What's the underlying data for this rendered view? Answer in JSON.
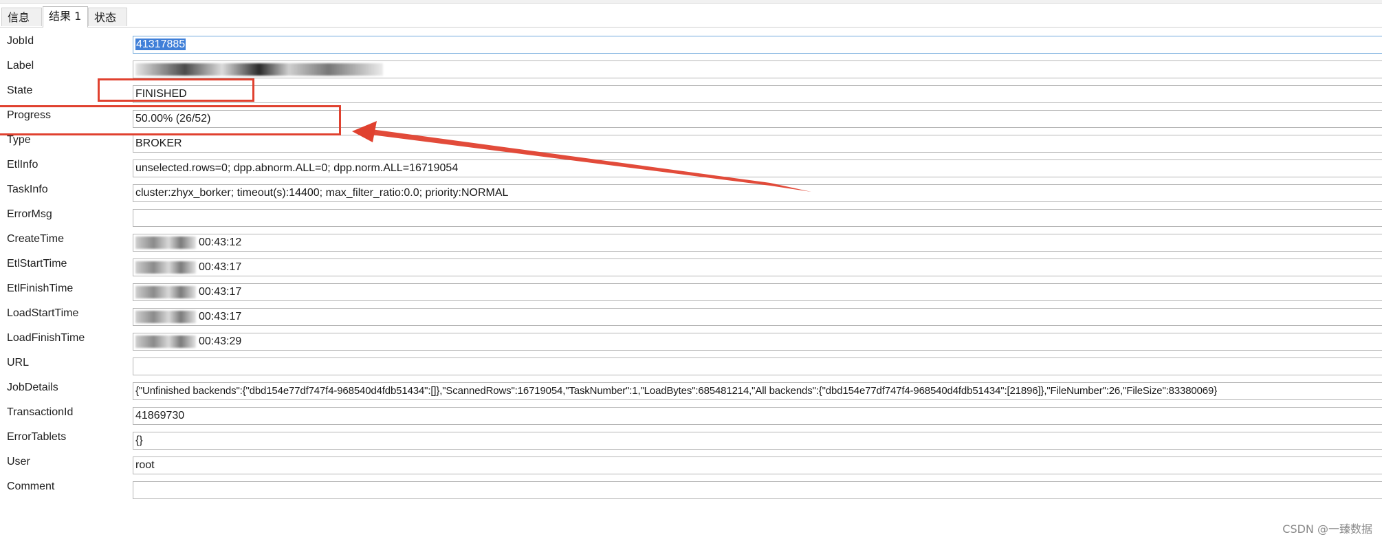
{
  "tabs": [
    {
      "label": "信息",
      "active": false
    },
    {
      "label": "结果 1",
      "active": true
    },
    {
      "label": "状态",
      "active": false
    }
  ],
  "fields": {
    "jobid": {
      "label": "JobId",
      "value": "41317885"
    },
    "label": {
      "label": "Label",
      "value": ""
    },
    "state": {
      "label": "State",
      "value": "FINISHED"
    },
    "progress": {
      "label": "Progress",
      "value": "50.00% (26/52)"
    },
    "type": {
      "label": "Type",
      "value": "BROKER"
    },
    "etlinfo": {
      "label": "EtlInfo",
      "value": "unselected.rows=0; dpp.abnorm.ALL=0; dpp.norm.ALL=16719054"
    },
    "taskinfo": {
      "label": "TaskInfo",
      "value": "cluster:zhyx_borker; timeout(s):14400; max_filter_ratio:0.0; priority:NORMAL"
    },
    "errormsg": {
      "label": "ErrorMsg",
      "value": ""
    },
    "createtime": {
      "label": "CreateTime",
      "value": "00:43:12"
    },
    "etlstarttime": {
      "label": "EtlStartTime",
      "value": "00:43:17"
    },
    "etlfinishtime": {
      "label": "EtlFinishTime",
      "value": "00:43:17"
    },
    "loadstarttime": {
      "label": "LoadStartTime",
      "value": "00:43:17"
    },
    "loadfinishtime": {
      "label": "LoadFinishTime",
      "value": "00:43:29"
    },
    "url": {
      "label": "URL",
      "value": ""
    },
    "jobdetails": {
      "label": "JobDetails",
      "value": "{\"Unfinished backends\":{\"dbd154e77df747f4-968540d4fdb51434\":[]},\"ScannedRows\":16719054,\"TaskNumber\":1,\"LoadBytes\":685481214,\"All backends\":{\"dbd154e77df747f4-968540d4fdb51434\":[21896]},\"FileNumber\":26,\"FileSize\":83380069}"
    },
    "transactionid": {
      "label": "TransactionId",
      "value": "41869730"
    },
    "errortablets": {
      "label": "ErrorTablets",
      "value": "{}"
    },
    "user": {
      "label": "User",
      "value": "root"
    },
    "comment": {
      "label": "Comment",
      "value": ""
    }
  },
  "watermark": "CSDN @一臻数据",
  "colors": {
    "annotation": "#e0412f",
    "selection": "#3f7fd8"
  }
}
